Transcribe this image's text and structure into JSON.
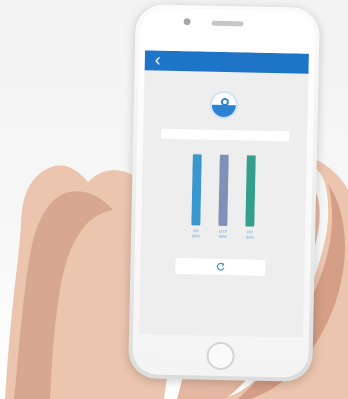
{
  "screen": {
    "nav": {
      "back_glyph": "‹",
      "back_icon": "chevron-left-icon",
      "accent_color": "#1e74c6"
    },
    "hero": {
      "icon": "water-drop-icon",
      "accent_color": "#2b83d1"
    },
    "status_field": {
      "value": ""
    },
    "filters": [
      {
        "label": "PP",
        "value_text": "98%",
        "value": 98,
        "color": "#3a96cf"
      },
      {
        "label": "MTF",
        "value_text": "98%",
        "value": 98,
        "color": "#7f90b9"
      },
      {
        "label": "RO",
        "value_text": "99%",
        "value": 99,
        "color": "#34a08c"
      }
    ],
    "refresh_icon": "refresh-icon"
  }
}
